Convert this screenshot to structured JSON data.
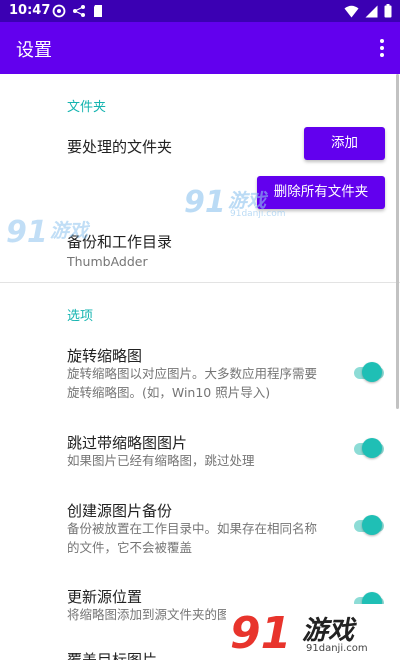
{
  "status_bar": {
    "time": "10:47"
  },
  "app_bar": {
    "title": "设置"
  },
  "folders": {
    "header": "文件夹",
    "folders_to_process": "要处理的文件夹",
    "add_button": "添加",
    "delete_all_button": "删除所有文件夹",
    "backup_dir_title": "备份和工作目录",
    "backup_dir_value": "ThumbAdder"
  },
  "options": {
    "header": "选项",
    "items": [
      {
        "title": "旋转缩略图",
        "summary_lines": [
          "旋转缩略图以对应图片。大多数应用程序需要",
          "旋转缩略图。(如，Win10 照片导入)"
        ],
        "checked": true
      },
      {
        "title": "跳过带缩略图图片",
        "summary_lines": [
          "如果图片已经有缩略图，跳过处理"
        ],
        "checked": true
      },
      {
        "title": "创建源图片备份",
        "summary_lines": [
          "备份被放置在工作目录中。如果存在相同名称",
          "的文件，它不会被覆盖"
        ],
        "checked": true
      },
      {
        "title": "更新源位置",
        "summary_lines": [
          "将缩略图添加到源文件夹的图片"
        ],
        "checked": true
      },
      {
        "title": "覆盖目标图片",
        "summary_lines": [],
        "checked": true
      }
    ]
  },
  "watermarks": {
    "small_logo_text": "游戏",
    "small_site": "91danji.com",
    "big_logo_text": "游戏",
    "big_site": "91danji.com",
    "brand_number": "91"
  },
  "colors": {
    "status_bar": "#3b00b3",
    "app_bar": "#6200ee",
    "accent": "#15b4b0",
    "switch_thumb": "#1fbfb5",
    "switch_track": "#8ddcd6"
  }
}
